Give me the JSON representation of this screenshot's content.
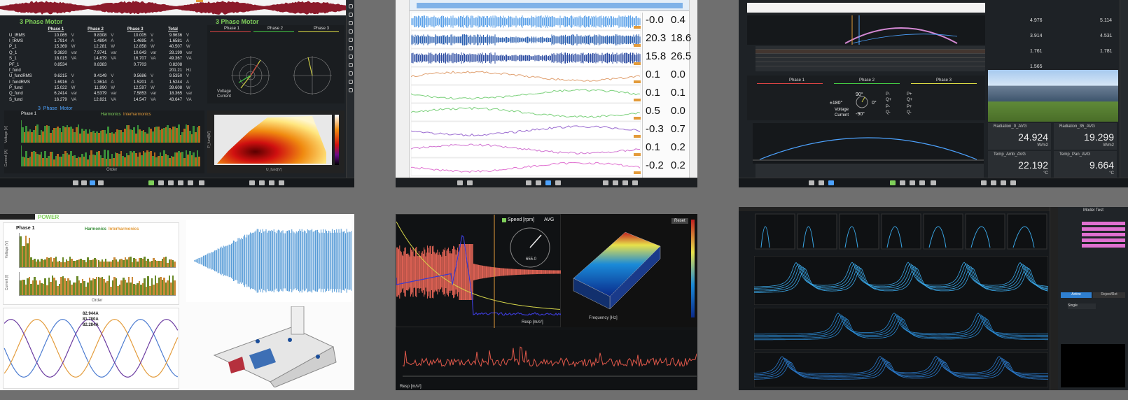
{
  "colors": {
    "accent_green": "#7fd05a",
    "accent_blue": "#4da3ff",
    "orange": "#e39b3a",
    "crimson": "#8b1a2a"
  },
  "panel1": {
    "title": "3 Phase Motor",
    "phasor_title": "3 Phase Motor",
    "section_title": "3_Phase_Motor",
    "phase_label": "Phase 1",
    "headers": [
      "Phase 1",
      "Phase 2",
      "Phase 3",
      "Total"
    ],
    "rows": [
      {
        "name": "U_tRMS",
        "v": [
          "10.065",
          "9.8308",
          "10.005",
          "9.9636"
        ],
        "u": [
          "V",
          "V",
          "V",
          "V"
        ]
      },
      {
        "name": "I_tRMS",
        "v": [
          "1.7914",
          "1.4894",
          "1.4695",
          "1.6581"
        ],
        "u": [
          "A",
          "A",
          "A",
          "A"
        ]
      },
      {
        "name": "P_1",
        "v": [
          "15.369",
          "12.281",
          "12.858",
          "40.507"
        ],
        "u": [
          "W",
          "W",
          "W",
          "W"
        ]
      },
      {
        "name": "Q_1",
        "v": [
          "9.3820",
          "7.9741",
          "10.643",
          "28.199"
        ],
        "u": [
          "var",
          "var",
          "var",
          "var"
        ]
      },
      {
        "name": "S_1",
        "v": [
          "18.015",
          "14.679",
          "16.707",
          "49.367"
        ],
        "u": [
          "VA",
          "VA",
          "VA",
          "VA"
        ]
      },
      {
        "name": "PF_1",
        "v": [
          "0.8534",
          "0.8383",
          "0.7703",
          "0.8208"
        ],
        "u": [
          "",
          "",
          "",
          ""
        ]
      },
      {
        "name": "f_fund",
        "v": [
          "",
          "",
          "",
          "201.21"
        ],
        "u": [
          "",
          "",
          "",
          "Hz"
        ]
      },
      {
        "name": "U_fundRMS",
        "v": [
          "9.6215",
          "9.4149",
          "9.5686",
          "9.5350"
        ],
        "u": [
          "V",
          "V",
          "V",
          "V"
        ]
      },
      {
        "name": "I_fundRMS",
        "v": [
          "1.6916",
          "1.3614",
          "1.5201",
          "1.5244"
        ],
        "u": [
          "A",
          "A",
          "A",
          "A"
        ]
      },
      {
        "name": "P_fund",
        "v": [
          "15.022",
          "11.990",
          "12.597",
          "39.608"
        ],
        "u": [
          "W",
          "W",
          "W",
          "W"
        ]
      },
      {
        "name": "Q_fund",
        "v": [
          "6.2414",
          "4.5379",
          "7.5853",
          "18.365"
        ],
        "u": [
          "var",
          "var",
          "var",
          "var"
        ]
      },
      {
        "name": "S_fund",
        "v": [
          "16.279",
          "12.821",
          "14.547",
          "43.647"
        ],
        "u": [
          "VA",
          "VA",
          "VA",
          "VA"
        ]
      }
    ],
    "phasor_headers": [
      "Phase 1",
      "Phase 2",
      "Phase 3"
    ],
    "phasor_legend": [
      "Voltage",
      "Current"
    ],
    "axis_ylabel_1": "Voltage [V]",
    "axis_ylabel_2": "Current [A]",
    "axis_xlabel": "Order",
    "legend_harm": [
      "Harmonics",
      "Interharmonics"
    ],
    "heat_xlabel": "U_fund[V]",
    "heat_ylabel": "P_fund[W]"
  },
  "panel2": {
    "values": [
      [
        "-0.0",
        "0.4"
      ],
      [
        "20.3",
        "18.6"
      ],
      [
        "15.8",
        "26.5"
      ],
      [
        "0.1",
        "0.0"
      ],
      [
        "0.1",
        "0.1"
      ],
      [
        "0.5",
        "0.0"
      ],
      [
        "-0.3",
        "0.7"
      ],
      [
        "0.1",
        "0.2"
      ],
      [
        "-0.2",
        "0.2"
      ]
    ]
  },
  "panel3": {
    "tiles": [
      {
        "name": "Radiation_0_AVG",
        "value": "24.924",
        "unit": "W/m2"
      },
      {
        "name": "Radiation_35_AVG",
        "value": "19.299",
        "unit": "W/m2"
      },
      {
        "name": "Temp_Amb_AVG",
        "value": "22.192",
        "unit": "°C"
      },
      {
        "name": "Temp_Pan_AVG",
        "value": "9.664",
        "unit": "°C"
      }
    ],
    "side_values": [
      "4.976",
      "5.114",
      "3.914",
      "4.531",
      "1.761",
      "1.781",
      "1.565"
    ],
    "phasor_labels": [
      "90°",
      "±180°",
      "0°",
      "-90°",
      "Voltage",
      "Current"
    ],
    "phase_headers": [
      "Phase 1",
      "Phase 2",
      "Phase 3"
    ],
    "quad_labels": [
      "P-",
      "P+",
      "Q+",
      "Q+",
      "P-",
      "P+",
      "Q-",
      "Q-"
    ]
  },
  "panel4": {
    "title": "POWER",
    "phase_label": "Phase 1",
    "legend": [
      "Harmonics",
      "Interharmonics"
    ],
    "xlabel": "Order",
    "ylabel_1": "Voltage [V]",
    "ylabel_2": "Current [I]",
    "readouts": [
      "82.944A",
      "81.780A",
      "82.284A"
    ]
  },
  "panel5": {
    "speed_label": "Speed [rpm]",
    "speed_mode": "AVG",
    "gauge_value": "655.0",
    "freq_xlabel": "Frequency [Hz]",
    "reset_label": "Reset",
    "legend_label": "Resp [m/s²]",
    "bottom_ylabel": "Resp [m/s²]"
  },
  "panel6": {
    "side_title": "Model Test",
    "tab_labels": [
      "Active",
      "Reject/Ret"
    ],
    "side_selected": "Single"
  }
}
